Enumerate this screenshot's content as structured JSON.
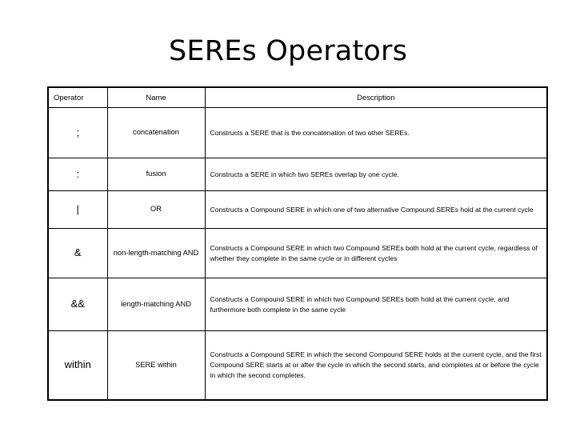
{
  "slide": {
    "title": "SEREs Operators"
  },
  "table": {
    "headers": {
      "operator": "Operator",
      "name": "Name",
      "description": "Description"
    },
    "rows": [
      {
        "operator": ";",
        "name": "concatenation",
        "description": "Constructs a SERE that is the concatenation of two other SEREs."
      },
      {
        "operator": ":",
        "name": "fusion",
        "description": "Constructs a SERE in which two SEREs overlap by one cycle."
      },
      {
        "operator": "|",
        "name": "OR",
        "description": "Constructs a Compound SERE in which one of two alternative Compound SEREs hold at the current cycle"
      },
      {
        "operator": "&",
        "name": "non-length-matching AND",
        "description": "Constructs a Compound SERE in which two Compound SEREs both hold at the current cycle, regardless of whether they complete in the same cycle or in different cycles"
      },
      {
        "operator": "&&",
        "name": "length-matching AND",
        "description": "Constructs a Compound SERE in which two Compound SEREs both hold at the current cycle, and furthermore both complete in the same cycle"
      },
      {
        "operator": "within",
        "name": "SERE within",
        "description": "Constructs a Compound SERE in which the second Compound SERE holds at the current cycle, and the first Compound SERE starts at or after the cycle in which the second starts, and completes at or before the cycle in which the second completes."
      }
    ]
  },
  "colors": {
    "background": "#ffffff",
    "text": "#000000",
    "border": "#000000"
  }
}
